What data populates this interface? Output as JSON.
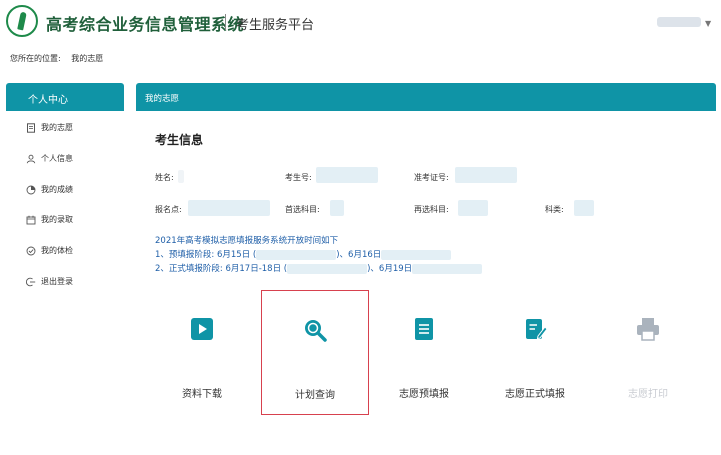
{
  "header": {
    "system_title": "高考综合业务信息管理系统",
    "platform": "考生服务平台"
  },
  "breadcrumb": {
    "prefix": "您所在的位置:",
    "current": "我的志愿"
  },
  "sidebar": {
    "title": "个人中心",
    "items": [
      {
        "label": "我的志愿",
        "icon": "document-icon"
      },
      {
        "label": "个人信息",
        "icon": "person-icon"
      },
      {
        "label": "我的成绩",
        "icon": "chart-icon"
      },
      {
        "label": "我的录取",
        "icon": "calendar-icon"
      },
      {
        "label": "我的体检",
        "icon": "check-circle-icon"
      },
      {
        "label": "退出登录",
        "icon": "logout-icon"
      }
    ]
  },
  "main": {
    "bar_title": "我的志愿",
    "section_title": "考生信息",
    "fields": {
      "name": "姓名:",
      "exam_no": "考生号:",
      "admission_no": "准考证号:",
      "site": "报名点:",
      "first_subject": "首选科目:",
      "second_subject": "再选科目:",
      "category": "科类:"
    },
    "notice": {
      "line1": "2021年高考模拟志愿填报服务系统开放时间如下",
      "line2_a": "1、预填报阶段: 6月15日 (",
      "line2_b": ")、6月16日",
      "line3_a": "2、正式填报阶段: 6月17日-18日 (",
      "line3_b": ")、6月19日"
    },
    "tiles": [
      {
        "label": "资料下载",
        "icon": "play-icon",
        "highlighted": false,
        "disabled": false
      },
      {
        "label": "计划查询",
        "icon": "search-icon",
        "highlighted": true,
        "disabled": false
      },
      {
        "label": "志愿预填报",
        "icon": "list-icon",
        "highlighted": false,
        "disabled": false
      },
      {
        "label": "志愿正式填报",
        "icon": "edit-icon",
        "highlighted": false,
        "disabled": false
      },
      {
        "label": "志愿打印",
        "icon": "printer-icon",
        "highlighted": false,
        "disabled": true
      }
    ]
  },
  "colors": {
    "accent": "#0f94a6",
    "highlight_border": "#d7414e",
    "notice_text": "#1f5fa8"
  }
}
